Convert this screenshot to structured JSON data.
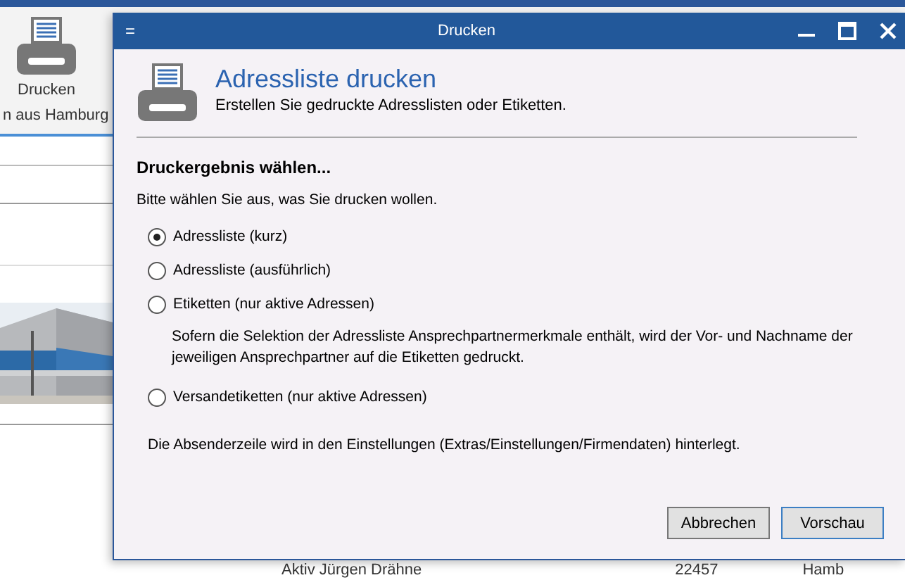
{
  "background_app": {
    "ribbon_button": "Drucken",
    "group_label": "n aus Hamburg",
    "row": [
      "Aktiv",
      "Jürgen Drähne",
      "22457",
      "Hamb"
    ]
  },
  "dialog": {
    "menu_glyph": "=",
    "title": "Drucken",
    "heading": "Adressliste drucken",
    "subheading": "Erstellen Sie gedruckte Adresslisten oder Etiketten.",
    "section_title": "Druckergebnis wählen...",
    "prompt": "Bitte wählen Sie aus, was Sie drucken wollen.",
    "options": [
      {
        "label": "Adressliste (kurz)",
        "selected": true
      },
      {
        "label": "Adressliste (ausführlich)",
        "selected": false
      },
      {
        "label": "Etiketten (nur aktive Adressen)",
        "selected": false,
        "note": "Sofern die Selektion der Adressliste Ansprechpartnermerkmale enthält, wird der Vor- und Nachname der jeweiligen Ansprechpartner auf die Etiketten gedruckt."
      },
      {
        "label": "Versandetiketten (nur aktive Adressen)",
        "selected": false
      }
    ],
    "footer_note": "Die Absenderzeile wird in den Einstellungen (Extras/Einstellungen/Firmendaten) hinterlegt.",
    "buttons": [
      {
        "label": "Abbrechen",
        "default": false
      },
      {
        "label": "Vorschau",
        "default": true
      }
    ]
  }
}
